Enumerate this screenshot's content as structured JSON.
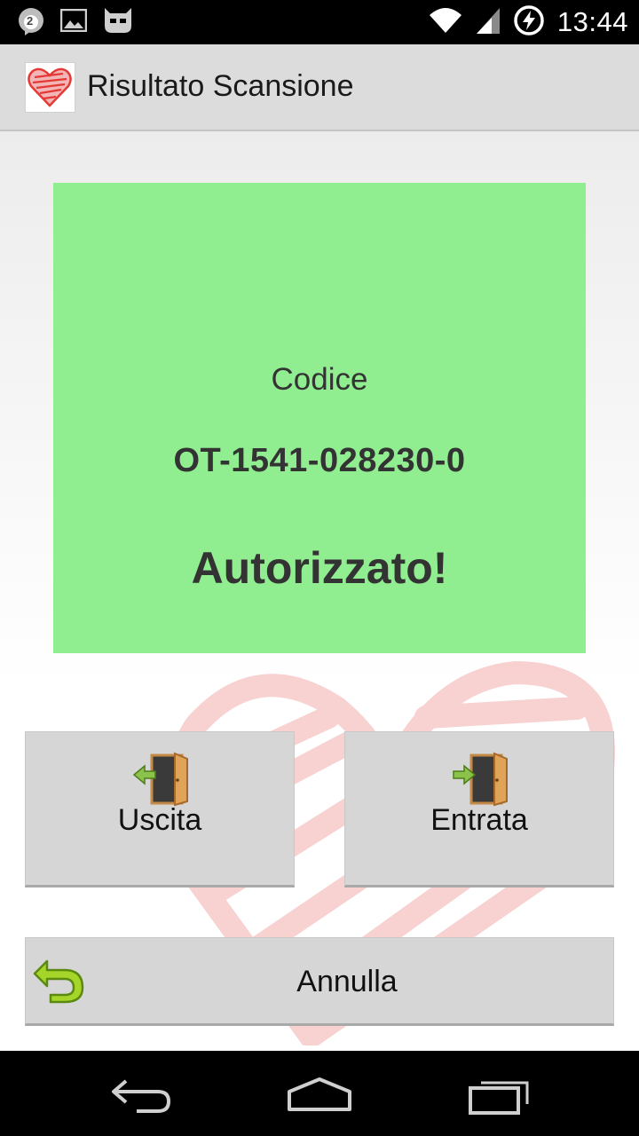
{
  "status_bar": {
    "notification_count": "2",
    "time": "13:44"
  },
  "action_bar": {
    "title": "Risultato Scansione"
  },
  "result": {
    "code_label": "Codice",
    "code_value": "OT-1541-028230-0",
    "status": "Autorizzato!",
    "panel_color": "#90ee90"
  },
  "buttons": {
    "exit_label": "Uscita",
    "enter_label": "Entrata",
    "cancel_label": "Annulla"
  },
  "icons": {
    "app": "heart-scribble-icon",
    "exit": "door-exit-icon",
    "enter": "door-enter-icon",
    "cancel": "undo-arrow-icon"
  }
}
